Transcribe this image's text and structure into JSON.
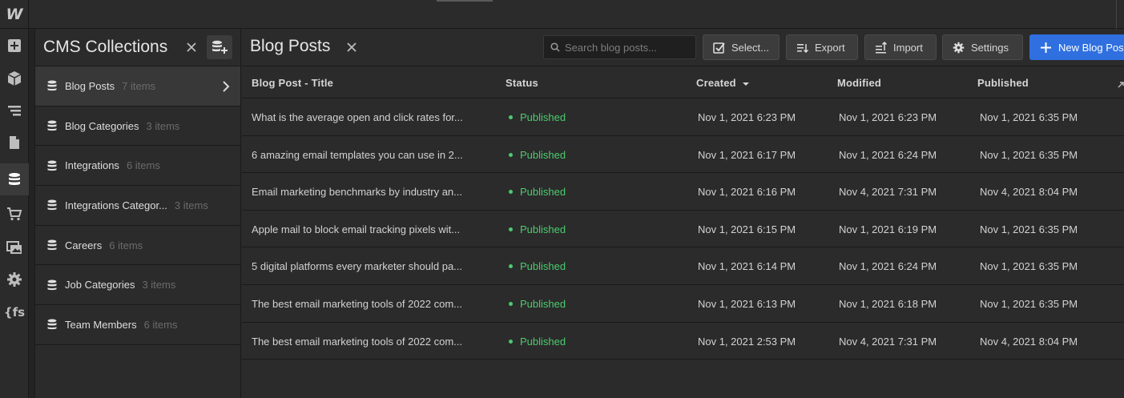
{
  "rail": {
    "logo": "W",
    "fs_label": "{fs"
  },
  "collections": {
    "title": "CMS Collections",
    "items": [
      {
        "name": "Blog Posts",
        "count": "7 items"
      },
      {
        "name": "Blog Categories",
        "count": "3 items"
      },
      {
        "name": "Integrations",
        "count": "6 items"
      },
      {
        "name": "Integrations Categor...",
        "count": "3 items"
      },
      {
        "name": "Careers",
        "count": "6 items"
      },
      {
        "name": "Job Categories",
        "count": "3 items"
      },
      {
        "name": "Team Members",
        "count": "6 items"
      }
    ]
  },
  "main": {
    "title": "Blog Posts",
    "search_placeholder": "Search blog posts...",
    "buttons": {
      "select": "Select...",
      "export": "Export",
      "import": "Import",
      "settings": "Settings",
      "new": "New Blog Post"
    },
    "columns": {
      "title": "Blog Post - Title",
      "status": "Status",
      "created": "Created",
      "modified": "Modified",
      "published": "Published"
    },
    "rows": [
      {
        "title": "What is the average open and click rates for...",
        "status": "Published",
        "created": "Nov 1, 2021 6:23 PM",
        "modified": "Nov 1, 2021 6:23 PM",
        "published": "Nov 1, 2021 6:35 PM"
      },
      {
        "title": "6 amazing email templates you can use in 2...",
        "status": "Published",
        "created": "Nov 1, 2021 6:17 PM",
        "modified": "Nov 1, 2021 6:24 PM",
        "published": "Nov 1, 2021 6:35 PM"
      },
      {
        "title": "Email marketing benchmarks by industry an...",
        "status": "Published",
        "created": "Nov 1, 2021 6:16 PM",
        "modified": "Nov 4, 2021 7:31 PM",
        "published": "Nov 4, 2021 8:04 PM"
      },
      {
        "title": "Apple mail to block email tracking pixels wit...",
        "status": "Published",
        "created": "Nov 1, 2021 6:15 PM",
        "modified": "Nov 1, 2021 6:19 PM",
        "published": "Nov 1, 2021 6:35 PM"
      },
      {
        "title": "5 digital platforms every marketer should pa...",
        "status": "Published",
        "created": "Nov 1, 2021 6:14 PM",
        "modified": "Nov 1, 2021 6:24 PM",
        "published": "Nov 1, 2021 6:35 PM"
      },
      {
        "title": "The best email marketing tools of 2022 com...",
        "status": "Published",
        "created": "Nov 1, 2021 6:13 PM",
        "modified": "Nov 1, 2021 6:18 PM",
        "published": "Nov 1, 2021 6:35 PM"
      },
      {
        "title": "The best email marketing tools of 2022 com...",
        "status": "Published",
        "created": "Nov 1, 2021 2:53 PM",
        "modified": "Nov 4, 2021 7:31 PM",
        "published": "Nov 4, 2021 8:04 PM"
      }
    ]
  },
  "colors": {
    "accent": "#2f6fe0",
    "published": "#4ccb6e",
    "background": "#2b2b2b"
  }
}
